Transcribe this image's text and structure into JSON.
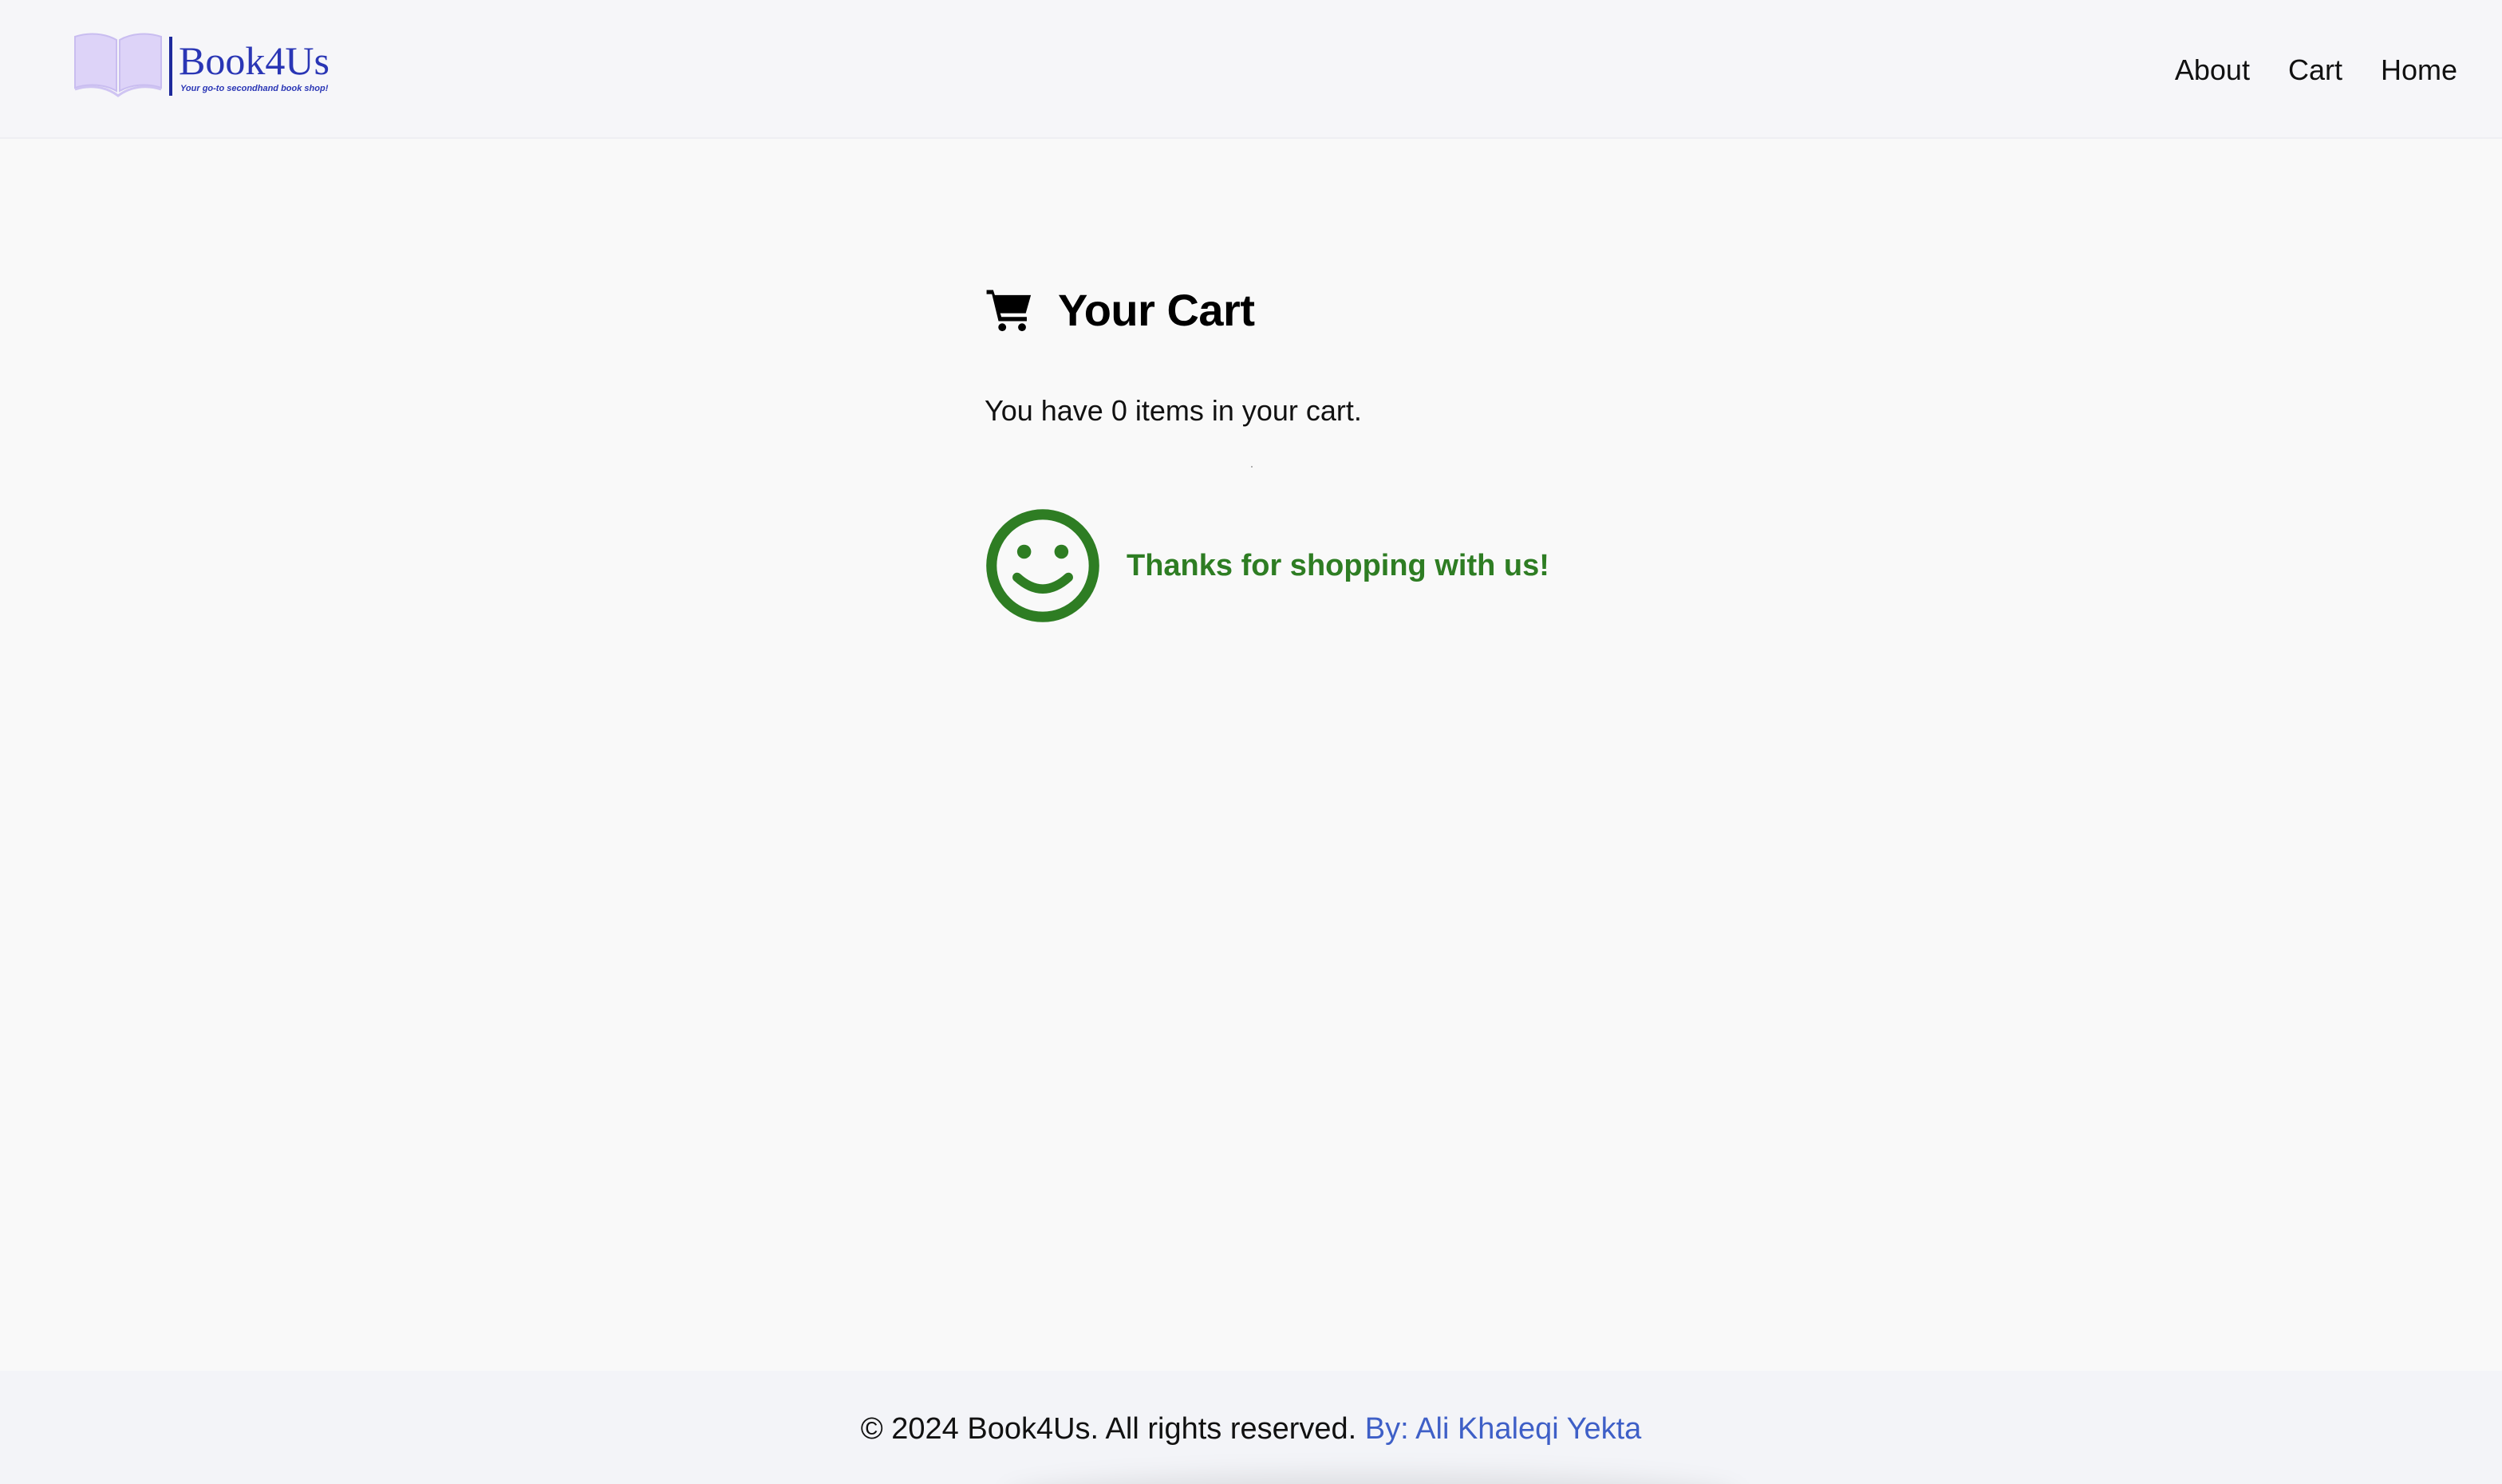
{
  "header": {
    "logo": {
      "name": "Book4Us",
      "tagline": "Your go-to secondhand book shop!",
      "brand_color": "#2a36b5",
      "book_color": "#ddd3f8"
    },
    "nav": [
      {
        "label": "About"
      },
      {
        "label": "Cart"
      },
      {
        "label": "Home"
      }
    ]
  },
  "main": {
    "title": "Your Cart",
    "title_icon": "shopping-cart-icon",
    "item_count_text": "You have 0 items in your cart.",
    "thanks_icon": "smiley-face-icon",
    "thanks_text": "Thanks for shopping with us!",
    "accent_green": "#2e7d23"
  },
  "footer": {
    "copyright": "© 2024 Book4Us. All rights reserved.",
    "author_link": "By: Ali Khaleqi Yekta",
    "link_color": "#3e5fc7"
  }
}
